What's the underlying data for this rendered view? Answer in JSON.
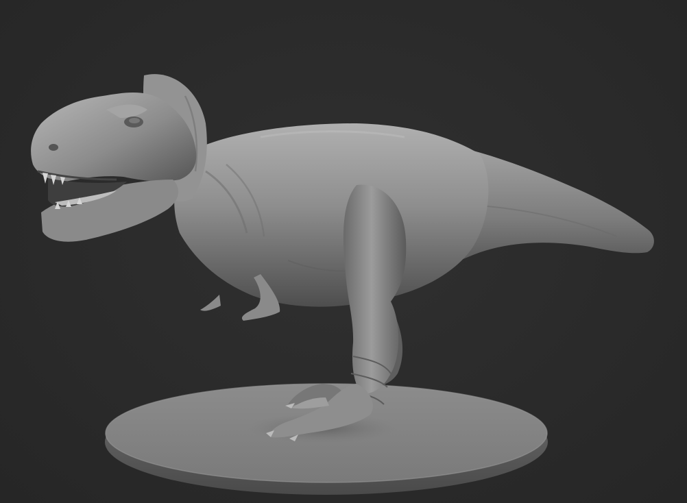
{
  "viewport": {
    "background_color": "#2b2b2b",
    "model_color": "#8a8a8a",
    "base_color": "#7e7e7e"
  },
  "model": {
    "subject": "tyrannosaurus-rex",
    "material": "gray-clay"
  }
}
